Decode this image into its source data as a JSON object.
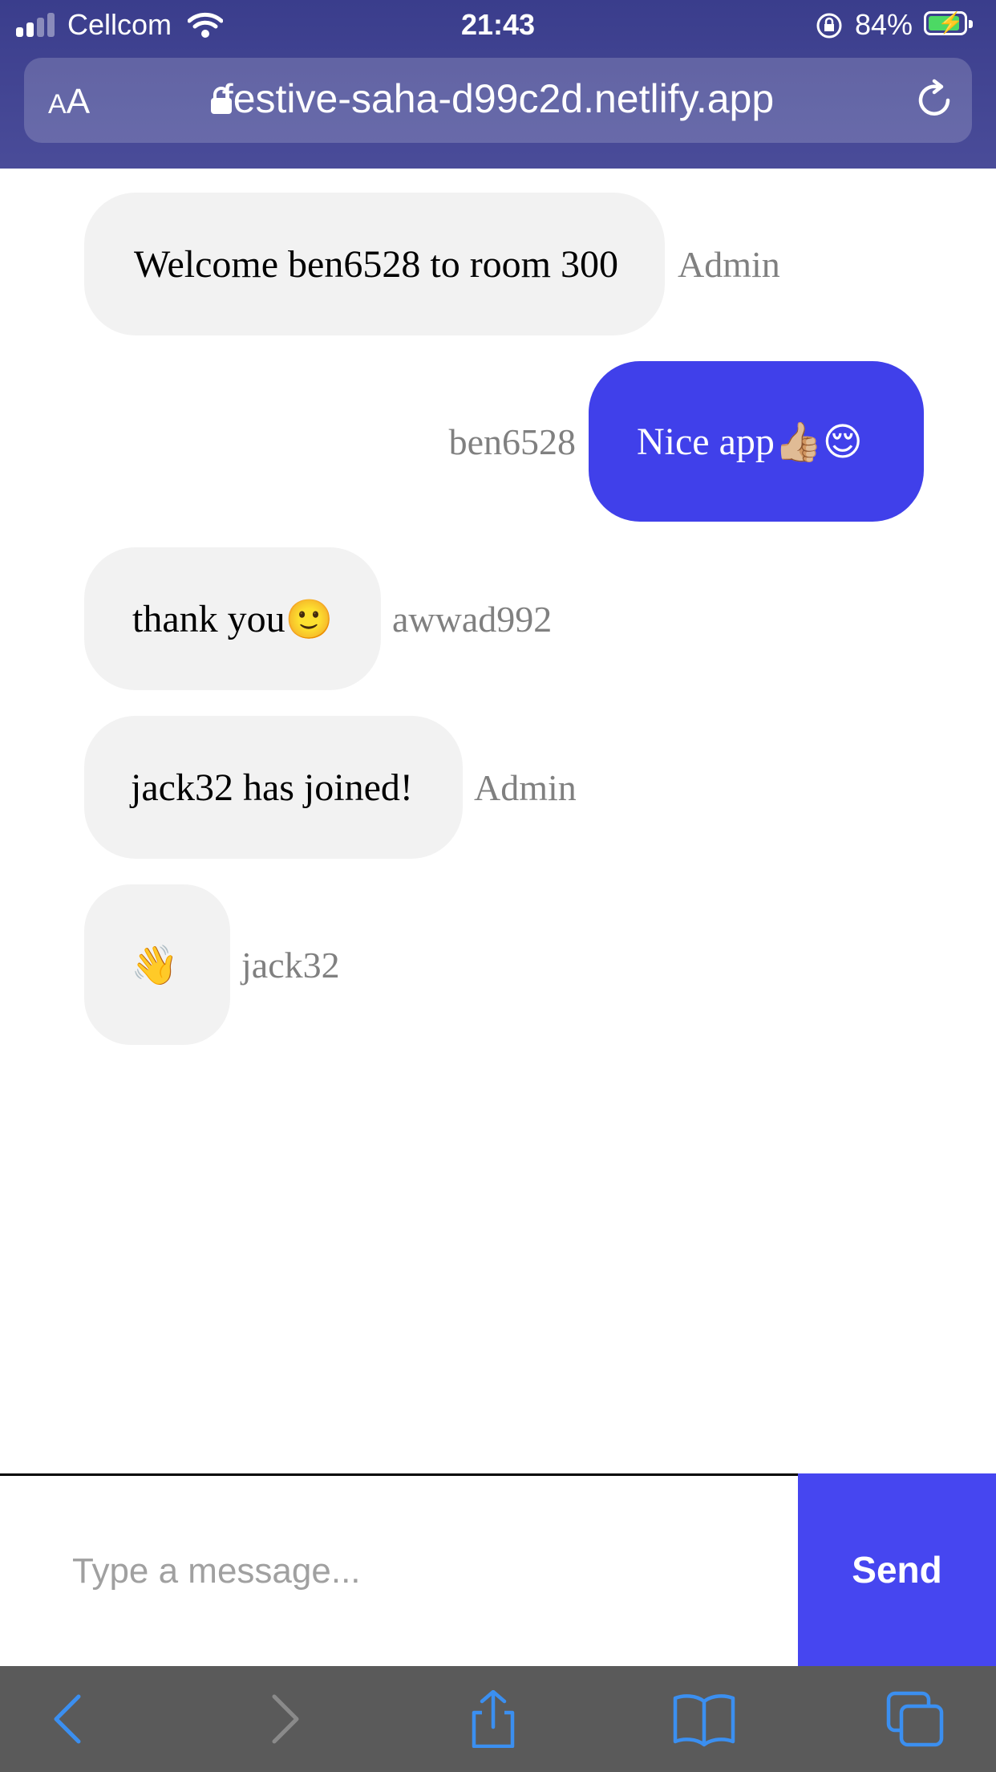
{
  "status_bar": {
    "carrier": "Cellcom",
    "time": "21:43",
    "battery_percent": "84%",
    "signal_bars": 2,
    "battery_charging": true
  },
  "browser": {
    "text_size_label_small": "A",
    "text_size_label_large": "A",
    "url": "festive-saha-d99c2d.netlify.app"
  },
  "chat": {
    "messages": [
      {
        "text": "Welcome ben6528 to room 300",
        "sender": "Admin",
        "own": false
      },
      {
        "text": "Nice app",
        "emoji": "👍🏼😌",
        "sender": "ben6528",
        "own": true
      },
      {
        "text": "thank you",
        "emoji": "🙂",
        "sender": "awwad992",
        "own": false
      },
      {
        "text": "jack32 has joined!",
        "sender": "Admin",
        "own": false
      },
      {
        "text": "",
        "emoji": "👋",
        "sender": "jack32",
        "own": false
      }
    ]
  },
  "composer": {
    "placeholder": "Type a message...",
    "send_label": "Send"
  },
  "colors": {
    "accent": "#4646f0",
    "own_bubble": "#4040ea",
    "other_bubble": "#f2f2f2",
    "sender_text": "#808080",
    "toolbar_icon": "#3b8ff0"
  },
  "toolbar": {
    "icons": [
      "back-icon",
      "forward-icon",
      "share-icon",
      "bookmarks-icon",
      "tabs-icon"
    ]
  }
}
